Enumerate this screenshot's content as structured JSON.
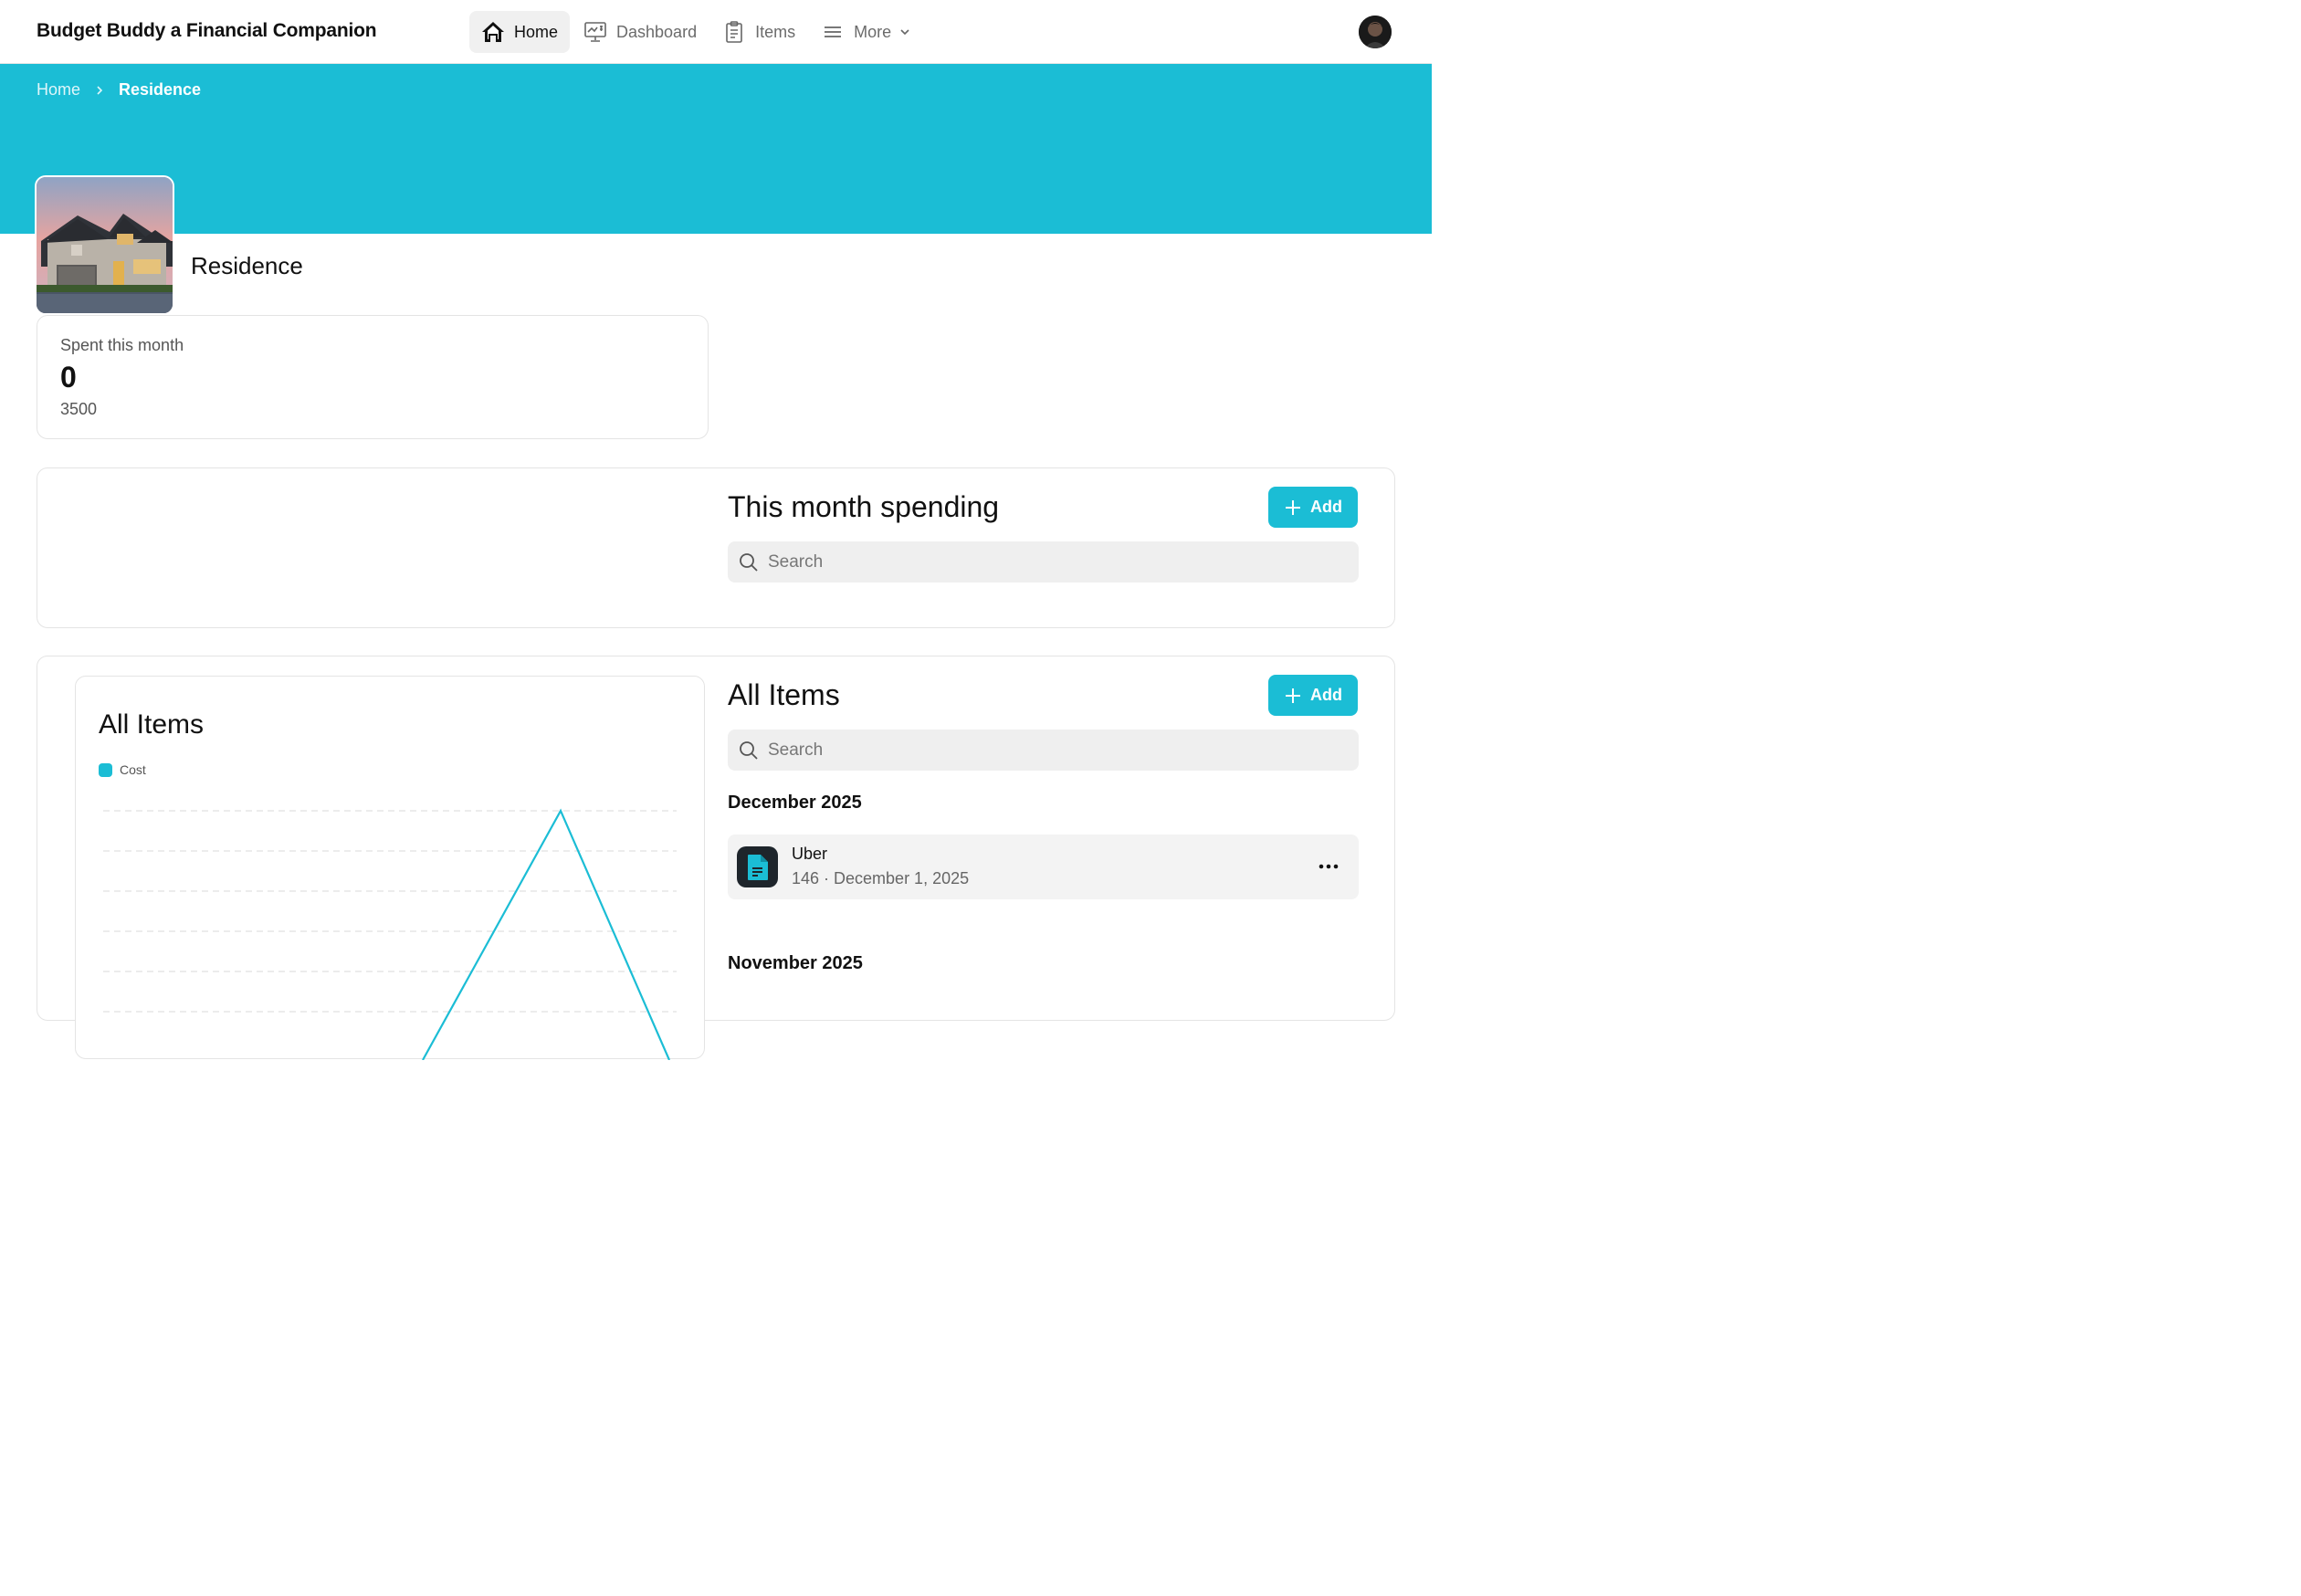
{
  "app": {
    "title": "Budget Buddy a Financial Companion"
  },
  "nav": {
    "items": [
      {
        "label": "Home",
        "icon": "home-icon",
        "active": true
      },
      {
        "label": "Dashboard",
        "icon": "dashboard-icon",
        "active": false
      },
      {
        "label": "Items",
        "icon": "clipboard-icon",
        "active": false
      },
      {
        "label": "More",
        "icon": "menu-icon",
        "active": false
      }
    ]
  },
  "breadcrumb": {
    "home": "Home",
    "current": "Residence"
  },
  "page": {
    "title": "Residence"
  },
  "stat": {
    "label": "Spent this month",
    "value": "0",
    "sub": "3500"
  },
  "spending": {
    "title": "This month spending",
    "add_label": "Add",
    "search_placeholder": "Search"
  },
  "all_items": {
    "title": "All Items",
    "add_label": "Add",
    "search_placeholder": "Search",
    "groups": [
      {
        "month": "December 2025",
        "items": [
          {
            "name": "Uber",
            "meta": "146 · December 1, 2025"
          }
        ]
      },
      {
        "month": "November 2025",
        "items": []
      }
    ]
  },
  "chart_data": {
    "type": "line",
    "title": "All Items",
    "series": [
      {
        "name": "Cost",
        "color": "#1bbdd5",
        "points": "single peak rising from lower-left to a top at about 80% across, then dropping"
      }
    ],
    "grid": true,
    "legend": "top-left"
  },
  "colors": {
    "accent": "#1bbdd5",
    "banner": "#1bbdd5"
  }
}
